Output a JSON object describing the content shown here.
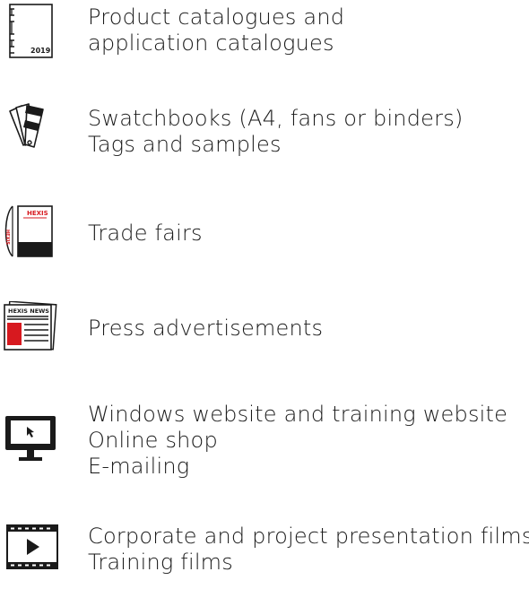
{
  "items": [
    {
      "icon": "catalogue-icon",
      "icon_label": "2019",
      "lines": [
        "Product catalogues and",
        "application catalogues"
      ]
    },
    {
      "icon": "swatchbook-fan-icon",
      "lines": [
        "Swatchbooks (A4, fans or binders)",
        "Tags and samples"
      ]
    },
    {
      "icon": "trade-fair-stand-icon",
      "icon_label": "HEXIS",
      "icon_side_label": "HEXIS",
      "lines": [
        "Trade fairs"
      ]
    },
    {
      "icon": "newspaper-icon",
      "icon_label": "HEXIS NEWS",
      "lines": [
        "Press advertisements"
      ]
    },
    {
      "icon": "monitor-cursor-icon",
      "lines": [
        "Windows website and training website",
        "Online shop",
        "E-mailing"
      ]
    },
    {
      "icon": "video-player-icon",
      "lines": [
        "Corporate and project presentation films",
        "Training films"
      ]
    }
  ],
  "colors": {
    "text": "#1a1a1a",
    "icon": "#1a1a1a",
    "accent": "#d7191f"
  }
}
